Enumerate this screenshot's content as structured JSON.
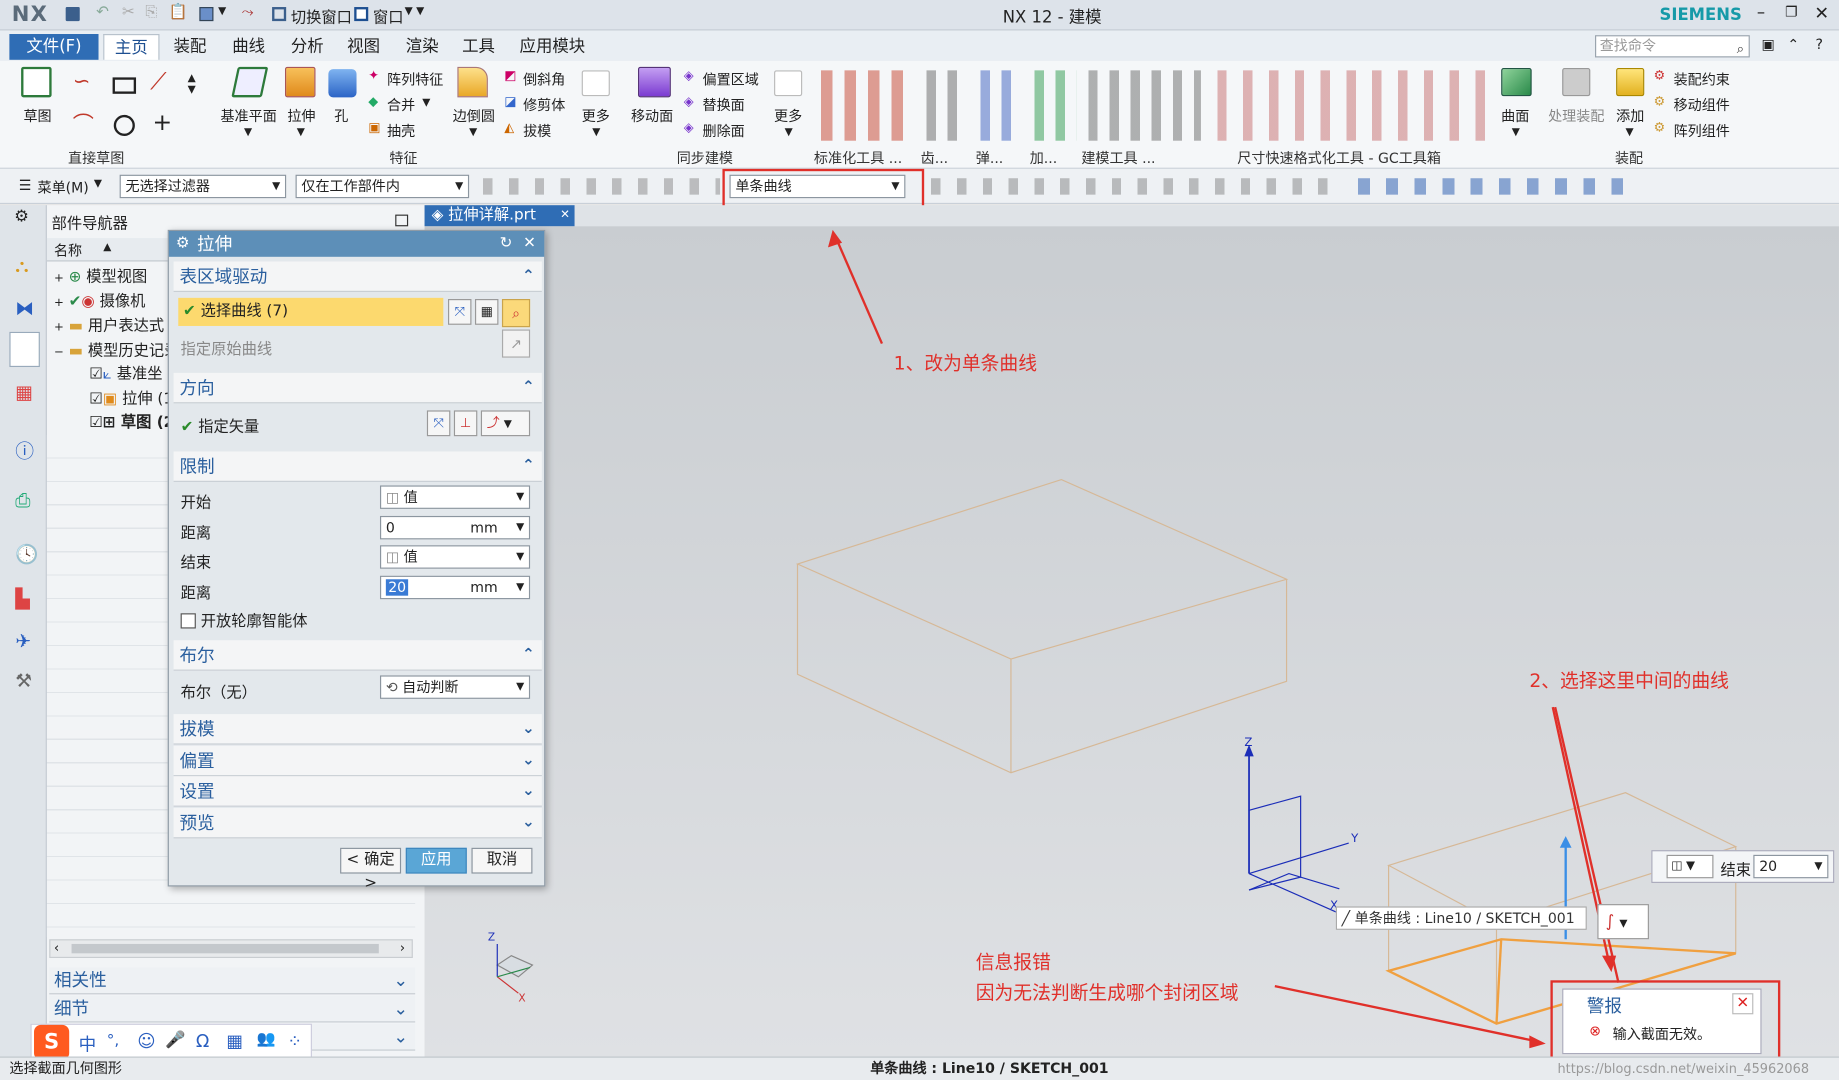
{
  "app": {
    "logo": "NX",
    "title": "NX 12 - 建模",
    "brand": "SIEMENS",
    "switch_window": "切换窗口",
    "window_menu": "窗口"
  },
  "menu_tabs": {
    "file": "文件(F)",
    "items": [
      "主页",
      "装配",
      "曲线",
      "分析",
      "视图",
      "渲染",
      "工具",
      "应用模块"
    ],
    "search_placeholder": "查找命令"
  },
  "ribbon": {
    "sketch": "草图",
    "groups": [
      "直接草图",
      "特征",
      "同步建模",
      "标准化工具 ...",
      "齿...",
      "弹...",
      "加...",
      "建模工具 ...",
      "尺寸快速格式化工具 - GC工具箱",
      "装配"
    ],
    "feature_buttons": [
      "基准平面",
      "拉伸",
      "孔"
    ],
    "feature_small": [
      "阵列特征",
      "合并",
      "抽壳"
    ],
    "edge_blend": "边倒圆",
    "blend_small": [
      "倒斜角",
      "修剪体",
      "拔模"
    ],
    "more": "更多",
    "move_face": "移动面",
    "sync_small": [
      "偏置区域",
      "替换面",
      "删除面"
    ],
    "more2": "更多",
    "surface": "曲面",
    "process_asm": "处理装配",
    "add": "添加",
    "asm_small": [
      "装配约束",
      "移动组件",
      "阵列组件"
    ]
  },
  "selbar": {
    "menu": "菜单(M)",
    "filter": "无选择过滤器",
    "scope": "仅在工作部件内",
    "curve_rule": "单条曲线"
  },
  "navigator": {
    "title": "部件导航器",
    "col_name": "名称",
    "items": [
      "模型视图",
      "摄像机",
      "用户表达式",
      "模型历史记录",
      "基准坐",
      "拉伸 (1",
      "草图 (2"
    ],
    "accordion": [
      "相关性",
      "细节",
      "预览"
    ]
  },
  "file_tab": "拉伸详解.prt",
  "dialog": {
    "title": "拉伸",
    "sec1": "表区域驱动",
    "select_curve": "选择曲线 (7)",
    "spec_orig_curve": "指定原始曲线",
    "sec2": "方向",
    "spec_vector": "指定矢量",
    "sec3": "限制",
    "start_label": "开始",
    "start_value": "值",
    "dist_label": "距离",
    "dist1": "0",
    "unit": "mm",
    "end_label": "结束",
    "end_value": "值",
    "dist2": "20",
    "open_profile": "开放轮廓智能体",
    "sec4": "布尔",
    "bool_label": "布尔（无）",
    "bool_value": "自动判断",
    "sec5": "拔模",
    "sec6": "偏置",
    "sec7": "设置",
    "sec8": "预览",
    "ok": "< 确定 >",
    "apply": "应用",
    "cancel": "取消"
  },
  "viewport": {
    "annot1": "1、改为单条曲线",
    "annot2": "2、选择这里中间的曲线",
    "annot3a": "信息报错",
    "annot3b": "因为无法判断生成哪个封闭区域",
    "tooltip": "单条曲线 : Line10 / SKETCH_001",
    "end_label": "结束",
    "end_val": "20",
    "axes": [
      "Z",
      "Y",
      "X"
    ]
  },
  "alert": {
    "title": "警报",
    "message": "输入截面无效。"
  },
  "statusbar": {
    "left": "选择截面几何图形",
    "center": "单条曲线 : Line10 / SKETCH_001",
    "watermark": "https://blog.csdn.net/weixin_45962068"
  },
  "ime": {
    "items": [
      "中",
      "°,",
      "☺",
      "🎤",
      "Ω",
      "▦",
      "👥",
      "⁘"
    ]
  },
  "colors": {
    "accent": "#2a5f9e",
    "highlight": "#fcd96e",
    "annotation": "#e0302a",
    "apply": "#5aa6d6"
  }
}
